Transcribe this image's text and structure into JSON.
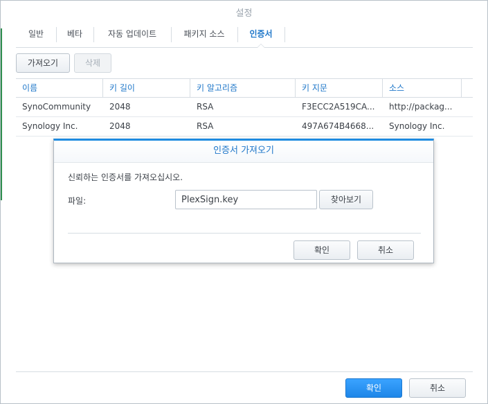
{
  "window": {
    "title": "설정"
  },
  "tabs": [
    {
      "label": "일반"
    },
    {
      "label": "베타"
    },
    {
      "label": "자동 업데이트"
    },
    {
      "label": "패키지 소스"
    },
    {
      "label": "인증서",
      "active": true
    }
  ],
  "toolbar": {
    "import_label": "가져오기",
    "delete_label": "삭제"
  },
  "grid": {
    "columns": [
      "이름",
      "키 길이",
      "키 알고리즘",
      "키 지문",
      "소스"
    ],
    "rows": [
      [
        "SynoCommunity",
        "2048",
        "RSA",
        "F3ECC2A519CA...",
        "http://packag..."
      ],
      [
        "Synology Inc.",
        "2048",
        "RSA",
        "497A674B4668...",
        "Synology Inc."
      ]
    ]
  },
  "dialog": {
    "title": "인증서 가져오기",
    "description": "신뢰하는 인증서를 가져오십시오.",
    "file_label": "파일:",
    "file_value": "PlexSign.key",
    "browse_label": "찾아보기",
    "ok_label": "확인",
    "cancel_label": "취소"
  },
  "footer": {
    "ok_label": "확인",
    "cancel_label": "취소"
  },
  "colors": {
    "accent": "#1f77c9",
    "primary_button": "#2a93f2",
    "dialog_top_border": "#1f8be0"
  }
}
